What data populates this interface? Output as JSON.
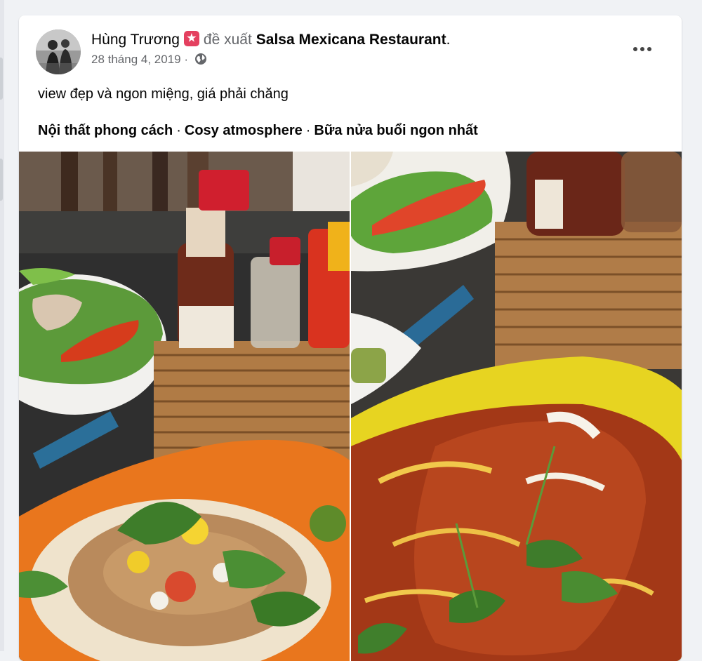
{
  "post": {
    "author": "Hùng Trương",
    "verb": "đề xuất",
    "page": "Salsa Mexicana Restaurant",
    "period": ".",
    "date": "28 tháng 4, 2019",
    "dot": "·",
    "text": "view đẹp và ngon miệng, giá phải chăng",
    "tags": [
      "Nội thất phong cách",
      "Cosy atmosphere",
      "Bữa nửa buổi ngon nhất"
    ],
    "tag_sep": "·"
  },
  "icons": {
    "badge": "recommend-star-icon",
    "privacy": "globe-icon",
    "more": "more-horizontal-icon"
  },
  "colors": {
    "background": "#f0f2f5",
    "card": "#ffffff",
    "text": "#050505",
    "secondary": "#65676b",
    "badge": "#e4405f"
  }
}
